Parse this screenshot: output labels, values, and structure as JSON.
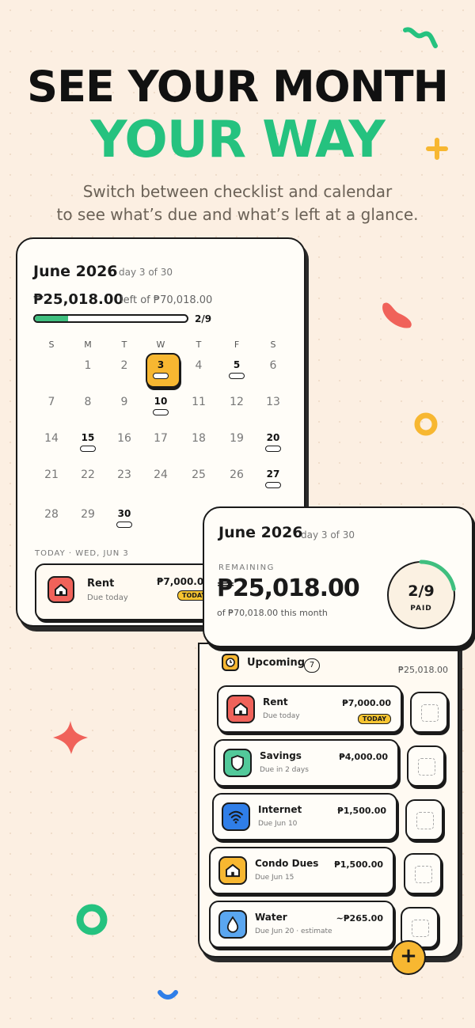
{
  "hero": {
    "line1": "SEE YOUR MONTH",
    "line2": "YOUR WAY",
    "sub1": "Switch between checklist and calendar",
    "sub2": "to see what’s due and what’s left at a glance."
  },
  "calendar": {
    "month": "June 2026",
    "day_progress": "day 3 of 30",
    "amount_left": "₱25,018.00",
    "left_of": "left of ₱70,018.00",
    "count": "2/9",
    "progress_fraction": 0.22,
    "weekdays": [
      "S",
      "M",
      "T",
      "W",
      "T",
      "F",
      "S"
    ],
    "days": [
      "1",
      "2",
      "3",
      "4",
      "5",
      "6",
      "7",
      "8",
      "9",
      "10",
      "11",
      "12",
      "13",
      "14",
      "15",
      "16",
      "17",
      "18",
      "19",
      "20",
      "21",
      "22",
      "23",
      "24",
      "25",
      "26",
      "27",
      "28",
      "29",
      "30"
    ],
    "today_label": "TODAY · WED, JUN 3",
    "today_item": {
      "name": "Rent",
      "due": "Due today",
      "amount": "₱7,000.0",
      "tag": "TODAY"
    }
  },
  "summary": {
    "month": "June 2026",
    "day_progress": "day 3 of 30",
    "remaining_label": "REMAINING",
    "remaining": "₱25,018.00",
    "of_total": "of ₱70,018.00 this month",
    "paid_count": "2/9",
    "paid_label": "PAID",
    "paid_fraction": 0.22
  },
  "upcoming": {
    "label": "Upcoming",
    "count": "7",
    "total": "₱25,018.00",
    "items": [
      {
        "name": "Rent",
        "due": "Due today",
        "amount": "₱7,000.00",
        "tag": "TODAY",
        "icon": "home-icon",
        "color": "#f0625a"
      },
      {
        "name": "Savings",
        "due": "Due in 2 days",
        "amount": "₱4,000.00",
        "tag": "",
        "icon": "shield-icon",
        "color": "#52c99a"
      },
      {
        "name": "Internet",
        "due": "Due Jun 10",
        "amount": "₱1,500.00",
        "tag": "",
        "icon": "wifi-icon",
        "color": "#2f7ee8"
      },
      {
        "name": "Condo Dues",
        "due": "Due Jun 15",
        "amount": "₱1,500.00",
        "tag": "",
        "icon": "home-icon",
        "color": "#f7b731"
      },
      {
        "name": "Water",
        "due": "Due Jun 20 · estimate",
        "amount": "~₱265.00",
        "tag": "",
        "icon": "droplet-icon",
        "color": "#5aa6f0"
      }
    ]
  },
  "fab_label": "+"
}
